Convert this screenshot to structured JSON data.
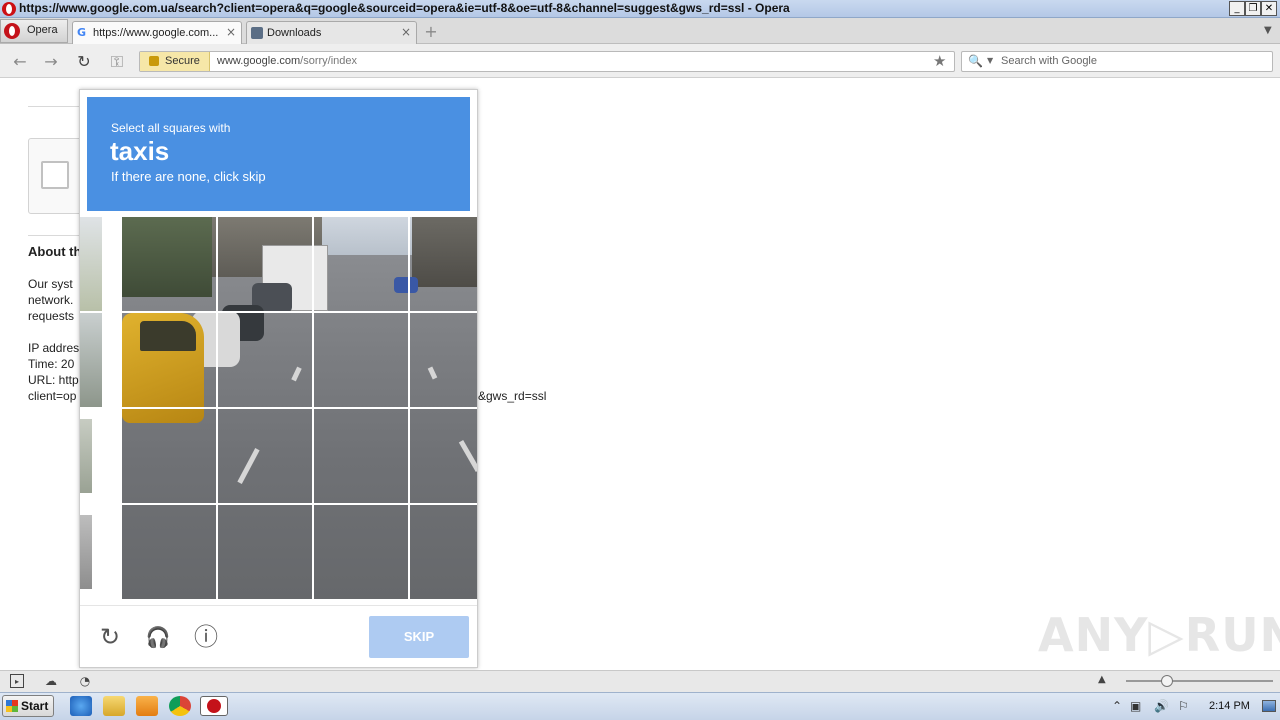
{
  "window": {
    "title": "https://www.google.com.ua/search?client=opera&q=google&sourceid=opera&ie=utf-8&oe=utf-8&channel=suggest&gws_rd=ssl - Opera",
    "controls": {
      "minimize": "_",
      "restore": "❐",
      "close": "✕"
    }
  },
  "tabs": {
    "menu_label": "Opera",
    "items": [
      {
        "label": "https://www.google.com...",
        "close": "×"
      },
      {
        "label": "Downloads",
        "close": "×"
      }
    ],
    "new_tab": "+"
  },
  "address_bar": {
    "secure_label": "Secure",
    "url_host": "www.google.com",
    "url_path": "/sorry/index",
    "search_placeholder": "Search with Google"
  },
  "page": {
    "about_heading": "About th",
    "lines": [
      "Our syst",
      "network.",
      "requests",
      "IP addres",
      "Time: 20",
      "URL: http",
      "client=op"
    ],
    "url_tail": "&gws_rd=ssl"
  },
  "captcha": {
    "instruction_small": "Select all squares with",
    "instruction_object": "taxis",
    "instruction_sub": "If there are none, click skip",
    "skip_label": "SKIP",
    "reload_icon": "↻",
    "audio_icon": "🎧",
    "info_icon": "ⓘ"
  },
  "watermark": "ANY▷RUN",
  "taskbar": {
    "start_label": "Start",
    "clock": "2:14 PM"
  },
  "colors": {
    "captcha_header": "#4a90e2",
    "skip_button": "#aecbf2",
    "secure_badge": "#f6e7a8"
  }
}
